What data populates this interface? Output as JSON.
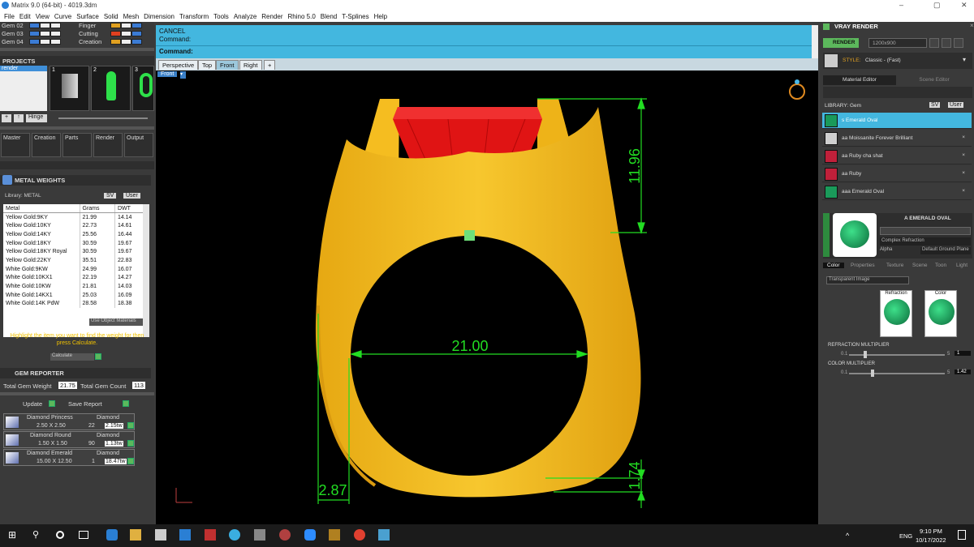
{
  "window": {
    "title": "Matrix 9.0 (64-bit) - 4019.3dm",
    "min": "–",
    "max": "▢",
    "close": "✕"
  },
  "menu": [
    "File",
    "Edit",
    "View",
    "Curve",
    "Surface",
    "Solid",
    "Mesh",
    "Dimension",
    "Transform",
    "Tools",
    "Analyze",
    "Render",
    "Rhino 5.0",
    "Blend",
    "T-Splines",
    "Help"
  ],
  "layers": {
    "left": [
      "Gem 02",
      "Gem 03",
      "Gem 04"
    ],
    "right": [
      "Finger",
      "Cutting",
      "Creation"
    ]
  },
  "projects": {
    "title": "PROJECTS",
    "items": [
      "render"
    ],
    "thumbs": [
      "1",
      "2",
      "3"
    ],
    "hinge_label": "Hinge"
  },
  "categories": [
    "Master",
    "Creation",
    "Parts",
    "Render",
    "Output"
  ],
  "metal_weights": {
    "title": "METAL WEIGHTS",
    "library_label": "Library: METAL",
    "cols": [
      "Metal",
      "Grams",
      "DWT"
    ],
    "rows": [
      [
        "Yellow Gold:9KY",
        "21.99",
        "14.14"
      ],
      [
        "Yellow Gold:10KY",
        "22.73",
        "14.61"
      ],
      [
        "Yellow Gold:14KY",
        "25.56",
        "16.44"
      ],
      [
        "Yellow Gold:18KY",
        "30.59",
        "19.67"
      ],
      [
        "Yellow Gold:18KY Royal",
        "30.59",
        "19.67"
      ],
      [
        "Yellow Gold:22KY",
        "35.51",
        "22.83"
      ],
      [
        "White Gold:9KW",
        "24.99",
        "16.07"
      ],
      [
        "White Gold:10KX1",
        "22.19",
        "14.27"
      ],
      [
        "White Gold:10KW",
        "21.81",
        "14.03"
      ],
      [
        "White Gold:14KX1",
        "25.03",
        "16.09"
      ],
      [
        "White Gold:14K PdW",
        "28.58",
        "18.38"
      ]
    ],
    "use_object": "Use Object Materials",
    "hint": "Highlight the item you want to find the weight for then press Calculate.",
    "calculate": "Calculate",
    "sv": "SV",
    "user": "User"
  },
  "gem_reporter": {
    "title": "GEM REPORTER",
    "total_weight_label": "Total Gem Weight",
    "total_weight": "21.75",
    "total_count_label": "Total Gem Count",
    "total_count": "113",
    "update": "Update",
    "save": "Save Report",
    "rows": [
      {
        "name": "Diamond Princess",
        "size": "2.50 X 2.50",
        "type": "Diamond",
        "count": "22",
        "ctw": "2.15tw"
      },
      {
        "name": "Diamond Round",
        "size": "1.50 X 1.50",
        "type": "Diamond",
        "count": "90",
        "ctw": "1.13tw"
      },
      {
        "name": "Diamond Emerald",
        "size": "15.00 X 12.50",
        "type": "Diamond",
        "count": "1",
        "ctw": "18.47tw"
      }
    ]
  },
  "command": {
    "line1": "CANCEL",
    "line2": "Command:",
    "prompt": "Command:"
  },
  "view_tabs": [
    "Perspective",
    "Top",
    "Front",
    "Right",
    "+"
  ],
  "active_view": "Front",
  "dimensions": {
    "top_height": "11.96",
    "width": "21.00",
    "shank": "2.87",
    "bottom": "1.74"
  },
  "vray": {
    "title": "VRAY RENDER",
    "render_btn": "RENDER",
    "resolution": "1200x900",
    "style_label": "STYLE:",
    "style_value": "Classic - (Fast)"
  },
  "material_editor": {
    "tab1": "Material Editor",
    "tab2": "Scene Editor",
    "library": "LIBRARY: Gem",
    "sv": "SV",
    "user": "User",
    "items": [
      {
        "name": "s Emerald Oval",
        "color": "#1a9a5a",
        "selected": true
      },
      {
        "name": "aa Moissanite Forever Brilliant",
        "color": "#cfcfcf",
        "selected": false
      },
      {
        "name": "aa Ruby cha shat",
        "color": "#c0203a",
        "selected": false
      },
      {
        "name": "aa Ruby",
        "color": "#c0203a",
        "selected": false
      },
      {
        "name": "aaa Emerald Oval",
        "color": "#1a9a5a",
        "selected": false
      }
    ],
    "preview_name": "A EMERALD OVAL",
    "type": "Complex Refraction",
    "alpha": "Alpha",
    "ground": "Default Ground Plane",
    "subtabs": [
      "Color",
      "Properties",
      "Texture",
      "Scene",
      "Toon",
      "Light"
    ],
    "transparent": "Transparent Image",
    "refraction": "Refraction",
    "color": "Color",
    "refr_mult_label": "REFRACTION MULTIPLIER",
    "refr_min": "0.1",
    "refr_max": "5",
    "refr_val": "1",
    "color_mult_label": "COLOR MULTIPLIER",
    "col_min": "0.1",
    "col_max": "5",
    "col_val": "1.42"
  },
  "taskbar": {
    "time": "9:10 PM",
    "date": "10/17/2022",
    "lang": "ENG"
  },
  "colors": {
    "gold": "#f2b81e",
    "ruby": "#e01010",
    "dim": "#22dd22",
    "accent": "#43b7df",
    "emerald": "#1a9a5a"
  }
}
